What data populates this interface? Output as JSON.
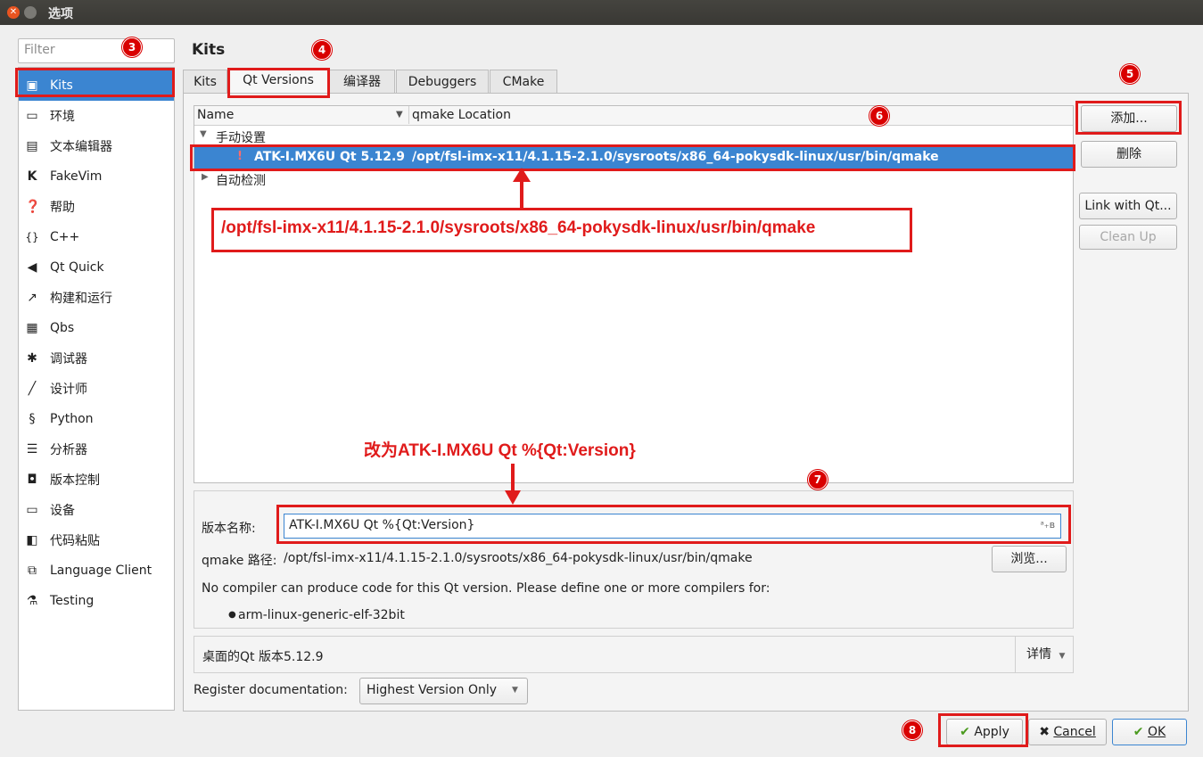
{
  "window": {
    "title": "选项"
  },
  "sidebar": {
    "filter_placeholder": "Filter",
    "items": [
      {
        "label": "Kits",
        "icon": "kits-icon"
      },
      {
        "label": "环境",
        "icon": "monitor-icon"
      },
      {
        "label": "文本编辑器",
        "icon": "text-editor-icon"
      },
      {
        "label": "FakeVim",
        "icon": "fakevim-icon"
      },
      {
        "label": "帮助",
        "icon": "help-icon"
      },
      {
        "label": "C++",
        "icon": "braces-icon"
      },
      {
        "label": "Qt Quick",
        "icon": "qtquick-icon"
      },
      {
        "label": "构建和运行",
        "icon": "hammer-icon"
      },
      {
        "label": "Qbs",
        "icon": "qbs-icon"
      },
      {
        "label": "调试器",
        "icon": "bug-icon"
      },
      {
        "label": "设计师",
        "icon": "pen-icon"
      },
      {
        "label": "Python",
        "icon": "python-icon"
      },
      {
        "label": "分析器",
        "icon": "analyzer-icon"
      },
      {
        "label": "版本控制",
        "icon": "version-control-icon"
      },
      {
        "label": "设备",
        "icon": "device-icon"
      },
      {
        "label": "代码粘贴",
        "icon": "clipboard-icon"
      },
      {
        "label": "Language Client",
        "icon": "language-client-icon"
      },
      {
        "label": "Testing",
        "icon": "testing-icon"
      }
    ]
  },
  "main": {
    "title": "Kits",
    "tabs": [
      "Kits",
      "Qt Versions",
      "编译器",
      "Debuggers",
      "CMake"
    ],
    "tree": {
      "col_name": "Name",
      "col_location": "qmake Location",
      "group_manual": "手动设置",
      "selected_name": "ATK-I.MX6U Qt 5.12.9",
      "selected_location": "/opt/fsl-imx-x11/4.1.15-2.1.0/sysroots/x86_64-pokysdk-linux/usr/bin/qmake",
      "group_auto": "自动检测"
    },
    "buttons": {
      "add": "添加...",
      "remove": "删除",
      "link": "Link with Qt...",
      "cleanup": "Clean Up"
    },
    "details": {
      "name_label": "版本名称:",
      "name_value": "ATK-I.MX6U Qt %{Qt:Version}",
      "qmake_label": "qmake 路径:",
      "qmake_path": "/opt/fsl-imx-x11/4.1.15-2.1.0/sysroots/x86_64-pokysdk-linux/usr/bin/qmake",
      "browse": "浏览...",
      "warning": "No compiler can produce code for this Qt version. Please define one or more compilers for:",
      "abi": "arm-linux-generic-elf-32bit"
    },
    "desktop": {
      "text": "桌面的Qt 版本5.12.9",
      "details_btn": "详情"
    },
    "register": {
      "label": "Register documentation:",
      "value": "Highest Version Only"
    }
  },
  "dialog_buttons": {
    "apply": "Apply",
    "cancel": "Cancel",
    "ok": "OK"
  },
  "annotations": {
    "path_callout": "/opt/fsl-imx-x11/4.1.15-2.1.0/sysroots/x86_64-pokysdk-linux/usr/bin/qmake",
    "rename_callout": "改为ATK-I.MX6U Qt %{Qt:Version}",
    "badges": [
      "3",
      "4",
      "5",
      "6",
      "7",
      "8"
    ]
  },
  "colors": {
    "selection": "#3b85d1",
    "annotation": "#e01b1b",
    "titlebar": "#3f3e3a"
  }
}
